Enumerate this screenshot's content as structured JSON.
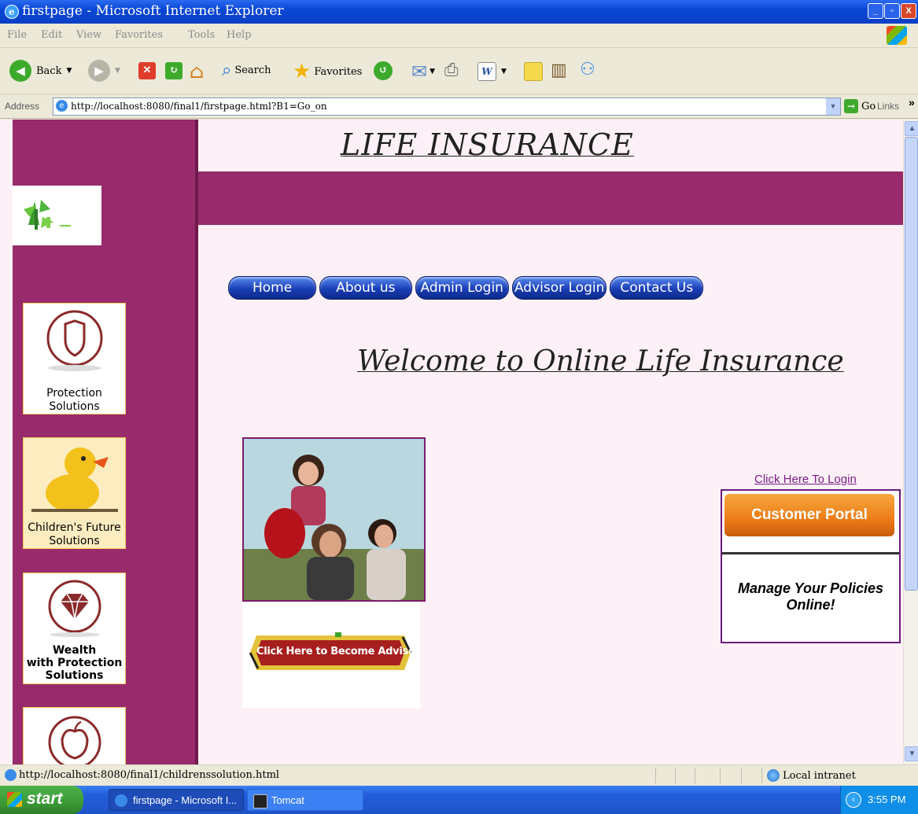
{
  "window": {
    "title": "firstpage - Microsoft Internet Explorer",
    "controls": {
      "minimize": "_",
      "maximize": "▫",
      "close": "X"
    }
  },
  "menubar": {
    "items": [
      "File",
      "Edit",
      "View",
      "Favorites",
      "Tools",
      "Help"
    ]
  },
  "toolbar": {
    "back_label": "Back",
    "search_label": "Search",
    "favorites_label": "Favorites",
    "icons": [
      "back-icon",
      "forward-icon",
      "stop-icon",
      "refresh-icon",
      "home-icon",
      "search-icon",
      "favorites-star-icon",
      "history-icon",
      "mail-icon",
      "print-icon",
      "edit-word-icon",
      "folder-icon",
      "research-icon",
      "messenger-icon"
    ]
  },
  "address": {
    "label": "Address",
    "url": "http://localhost:8080/final1/firstpage.html?B1=Go_on",
    "go_label": "Go",
    "links_label": "Links",
    "links_chevron": "»"
  },
  "page": {
    "title": "LIFE INSURANCE",
    "nav": [
      "Home",
      "About us",
      "Admin Login",
      "Advisor Login",
      "Contact Us"
    ],
    "welcome": "Welcome to Online Life Insurance",
    "sidebar_cards": [
      {
        "label_line1": "Protection",
        "label_line2": "Solutions",
        "icon": "shield-icon"
      },
      {
        "label_line1": "Children's Future",
        "label_line2": "Solutions",
        "icon": "rubber-duck-icon"
      },
      {
        "label_line1": "Wealth",
        "label_line2": "with Protection",
        "label_line3": "Solutions",
        "icon": "diamond-icon"
      },
      {
        "icon": "apple-icon"
      }
    ],
    "advisor_button_label": "Click Here to Become Advisor",
    "login_link": "Click Here To Login",
    "portal_button_label": "Customer Portal",
    "manage_text": "Manage Your Policies Online!"
  },
  "statusbar": {
    "text": "http://localhost:8080/final1/childrenssolution.html",
    "zone": "Local intranet"
  },
  "taskbar": {
    "start_label": "start",
    "tasks": [
      "firstpage - Microsoft I...",
      "Tomcat"
    ],
    "clock": "3:55 PM"
  },
  "colors": {
    "brand_purple": "#982b6b",
    "page_bg": "#fdf1f7",
    "nav_blue": "#1a3eb5",
    "portal_orange": "#ec7c17",
    "link_purple": "#7a1c8a"
  }
}
